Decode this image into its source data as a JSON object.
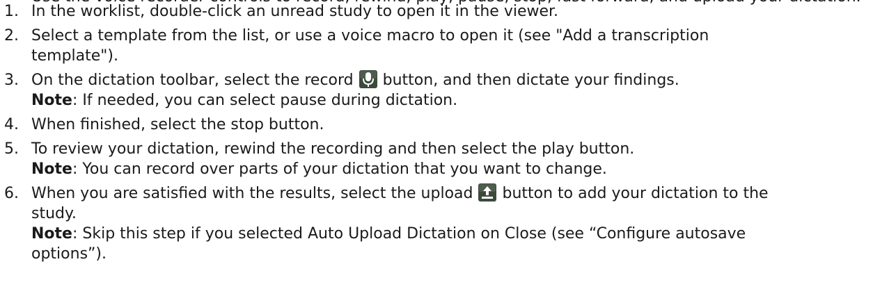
{
  "top_partial_text": "Use the voice recorder controls to record, rewind, play, pause, stop, fast forward, and upload your dictation.",
  "steps": [
    {
      "number": "1.",
      "line1": "In the worklist, double-click an unread study to open it in the viewer."
    },
    {
      "number": "2.",
      "line1": "Select a template from the list, or use a voice macro to open it (see \"Add a transcription",
      "line2": "template\")."
    },
    {
      "number": "3.",
      "before_icon": "On the dictation toolbar, select the record ",
      "icon": "microphone-icon",
      "after_icon": " button, and then dictate your findings.",
      "note_label": "Note",
      "note_text": ": If needed, you can select pause during dictation."
    },
    {
      "number": "4.",
      "line1": "When finished, select the stop button."
    },
    {
      "number": "5.",
      "line1": "To review your dictation, rewind the recording and then select the play button.",
      "note_label": "Note",
      "note_text": ": You can record over parts of your dictation that you want to change."
    },
    {
      "number": "6.",
      "before_icon": "When you are satisfied with the results, select the upload ",
      "icon": "upload-icon",
      "after_icon": " button to add your dictation to the",
      "line2": "study.",
      "note_label": "Note",
      "note_text1": ": Skip this step if you selected Auto Upload Dictation on Close (see “Configure autosave",
      "note_text2": "options”)."
    }
  ],
  "colors": {
    "text": "#1a1a1a",
    "icon_bg": "#3c4a3c",
    "icon_fg": "#ffffff"
  }
}
